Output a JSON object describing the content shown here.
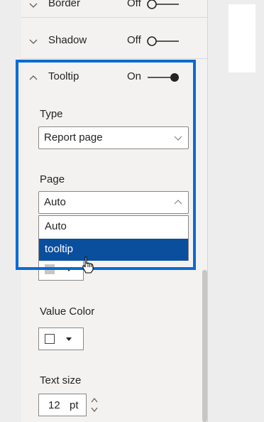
{
  "format_pane": {
    "sections": {
      "border": {
        "title": "Border",
        "toggle_label": "Off",
        "state": "off"
      },
      "shadow": {
        "title": "Shadow",
        "toggle_label": "Off",
        "state": "off"
      },
      "tooltip": {
        "title": "Tooltip",
        "toggle_label": "On",
        "state": "on"
      }
    },
    "tooltip": {
      "type_label": "Type",
      "type_value": "Report page",
      "page_label": "Page",
      "page_value": "Auto",
      "page_options": [
        "Auto",
        "tooltip"
      ],
      "highlighted_option": "tooltip"
    },
    "value_color_label": "Value Color",
    "text_size_label": "Text size",
    "text_size_value": "12",
    "text_size_unit": "pt"
  },
  "colors": {
    "highlight_border": "#0b6bd3",
    "selected_option_bg": "#0a4f9e",
    "toggle_on": "#252423",
    "toggle_off": "#252423"
  },
  "icons": [
    "chevron-down-icon",
    "chevron-up-icon",
    "toggle-icon",
    "dropdown-caret-icon",
    "hand-cursor-icon",
    "spinner-arrows-icon"
  ]
}
